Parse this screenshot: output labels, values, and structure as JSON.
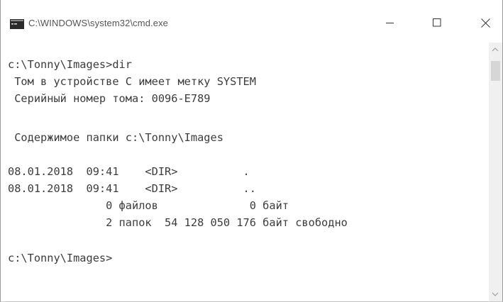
{
  "window": {
    "title": "C:\\WINDOWS\\system32\\cmd.exe",
    "app_icon": "cmd-icon",
    "controls": {
      "minimize_icon": "minimize-icon",
      "maximize_icon": "maximize-icon",
      "close_icon": "close-icon"
    }
  },
  "console": {
    "lines": [
      "c:\\Tonny\\Images>dir",
      " Том в устройстве C имеет метку SYSTEM",
      " Серийный номер тома: 0096-E789",
      "",
      " Содержимое папки c:\\Tonny\\Images",
      "",
      "08.01.2018  09:41    <DIR>          .",
      "08.01.2018  09:41    <DIR>          ..",
      "               0 файлов              0 байт",
      "               2 папок  54 128 050 176 байт свободно",
      "",
      "c:\\Tonny\\Images>"
    ]
  },
  "colors": {
    "text": "#3c3c3c",
    "background": "#ffffff",
    "title_text": "#555555"
  }
}
